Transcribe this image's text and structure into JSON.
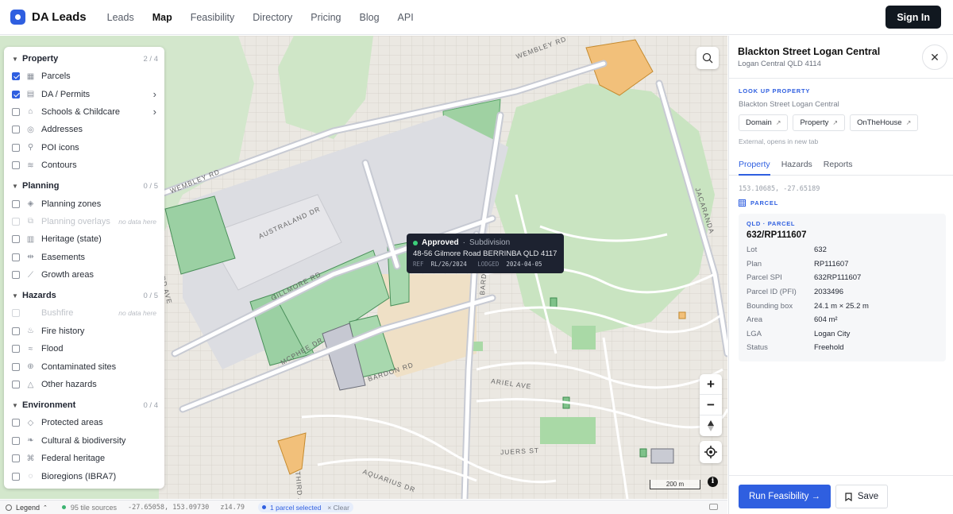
{
  "app": {
    "name": "DA Leads"
  },
  "nav": [
    {
      "label": "Leads",
      "active": false
    },
    {
      "label": "Map",
      "active": true
    },
    {
      "label": "Feasibility",
      "active": false
    },
    {
      "label": "Directory",
      "active": false
    },
    {
      "label": "Pricing",
      "active": false
    },
    {
      "label": "Blog",
      "active": false
    },
    {
      "label": "API",
      "active": false
    }
  ],
  "signin_label": "Sign In",
  "layers": {
    "groups": [
      {
        "name": "Property",
        "count": "2 / 4",
        "items": [
          {
            "label": "Parcels",
            "checked": true,
            "icon": "grid-icon",
            "enabled": true
          },
          {
            "label": "DA / Permits",
            "checked": true,
            "icon": "document-icon",
            "enabled": true,
            "submenu": true
          },
          {
            "label": "Schools & Childcare",
            "checked": false,
            "icon": "school-icon",
            "enabled": true,
            "submenu": true
          },
          {
            "label": "Addresses",
            "checked": false,
            "icon": "pin-icon",
            "enabled": true
          },
          {
            "label": "POI icons",
            "checked": false,
            "icon": "poi-pin-icon",
            "enabled": true
          },
          {
            "label": "Contours",
            "checked": false,
            "icon": "contour-icon",
            "enabled": true
          }
        ]
      },
      {
        "name": "Planning",
        "count": "0 / 5",
        "items": [
          {
            "label": "Planning zones",
            "checked": false,
            "icon": "layers-icon",
            "enabled": true
          },
          {
            "label": "Planning overlays",
            "checked": false,
            "icon": "overlay-icon",
            "enabled": false,
            "note": "no data here"
          },
          {
            "label": "Heritage (state)",
            "checked": false,
            "icon": "heritage-icon",
            "enabled": true
          },
          {
            "label": "Easements",
            "checked": false,
            "icon": "easement-icon",
            "enabled": true
          },
          {
            "label": "Growth areas",
            "checked": false,
            "icon": "chart-icon",
            "enabled": true
          }
        ]
      },
      {
        "name": "Hazards",
        "count": "0 / 5",
        "items": [
          {
            "label": "Bushfire",
            "checked": false,
            "icon": "",
            "enabled": false,
            "note": "no data here"
          },
          {
            "label": "Fire history",
            "checked": false,
            "icon": "flame-icon",
            "enabled": true
          },
          {
            "label": "Flood",
            "checked": false,
            "icon": "flood-icon",
            "enabled": true
          },
          {
            "label": "Contaminated sites",
            "checked": false,
            "icon": "hazard-circle-icon",
            "enabled": true
          },
          {
            "label": "Other hazards",
            "checked": false,
            "icon": "warning-icon",
            "enabled": true
          }
        ]
      },
      {
        "name": "Environment",
        "count": "0 / 4",
        "items": [
          {
            "label": "Protected areas",
            "checked": false,
            "icon": "shield-icon",
            "enabled": true
          },
          {
            "label": "Cultural & biodiversity",
            "checked": false,
            "icon": "leaf-icon",
            "enabled": true
          },
          {
            "label": "Federal heritage",
            "checked": false,
            "icon": "federal-icon",
            "enabled": true
          },
          {
            "label": "Bioregions (IBRA7)",
            "checked": false,
            "icon": "region-icon",
            "enabled": true
          }
        ]
      }
    ]
  },
  "map": {
    "streets": [
      "WEMBLEY RD",
      "WEMBLEY RD",
      "AUSTRALAND DR",
      "GILLMORE RD",
      "MCPHEE DR",
      "BARDON RD",
      "ARIEL AVE",
      "JUERS ST",
      "AQUARIUS DR",
      "THIRD AVE",
      "THIRD AVE",
      "BARDON RD",
      "JACARANDA"
    ],
    "scale_label": "200 m"
  },
  "tooltip": {
    "status": "Approved",
    "type": "Subdivision",
    "address": "48-56 Gilmore Road BERRINBA QLD 4117",
    "ref_key": "REF",
    "ref": "RL/26/2024",
    "lodged_key": "LODGED",
    "lodged": "2024-04-05"
  },
  "statusbar": {
    "legend": "Legend",
    "tiles": "95 tile sources",
    "coords": "-27.65058, 153.09730",
    "zoom": "z14.79",
    "selection": "1 parcel selected",
    "clear": "× Clear"
  },
  "panel": {
    "title": "Blackton Street Logan Central",
    "subtitle": "Logan Central QLD 4114",
    "lookup_heading": "LOOK UP PROPERTY",
    "lookup_address": "Blackton Street Logan Central",
    "external_links": [
      "Domain",
      "Property",
      "OnTheHouse"
    ],
    "external_note": "External, opens in new tab",
    "tabs": [
      "Property",
      "Hazards",
      "Reports"
    ],
    "coords": "153.10685, -27.65189",
    "parcel_heading": "PARCEL",
    "card": {
      "kicker": "QLD · PARCEL",
      "id": "632/RP111607",
      "rows": [
        {
          "k": "Lot",
          "v": "632"
        },
        {
          "k": "Plan",
          "v": "RP111607"
        },
        {
          "k": "Parcel SPI",
          "v": "632RP111607"
        },
        {
          "k": "Parcel ID (PFI)",
          "v": "2033496"
        },
        {
          "k": "Bounding box",
          "v": "24.1 m × 25.2 m"
        },
        {
          "k": "Area",
          "v": "604 m²"
        },
        {
          "k": "LGA",
          "v": "Logan City"
        },
        {
          "k": "Status",
          "v": "Freehold"
        }
      ]
    },
    "run_label": "Run Feasibility →",
    "save_label": "Save"
  },
  "colors": {
    "accent": "#2f5fe0",
    "park": "#cfe6c7",
    "parcel_green": "#8fc79a",
    "approved": "#3ccf7a",
    "orange": "#f0b764"
  }
}
